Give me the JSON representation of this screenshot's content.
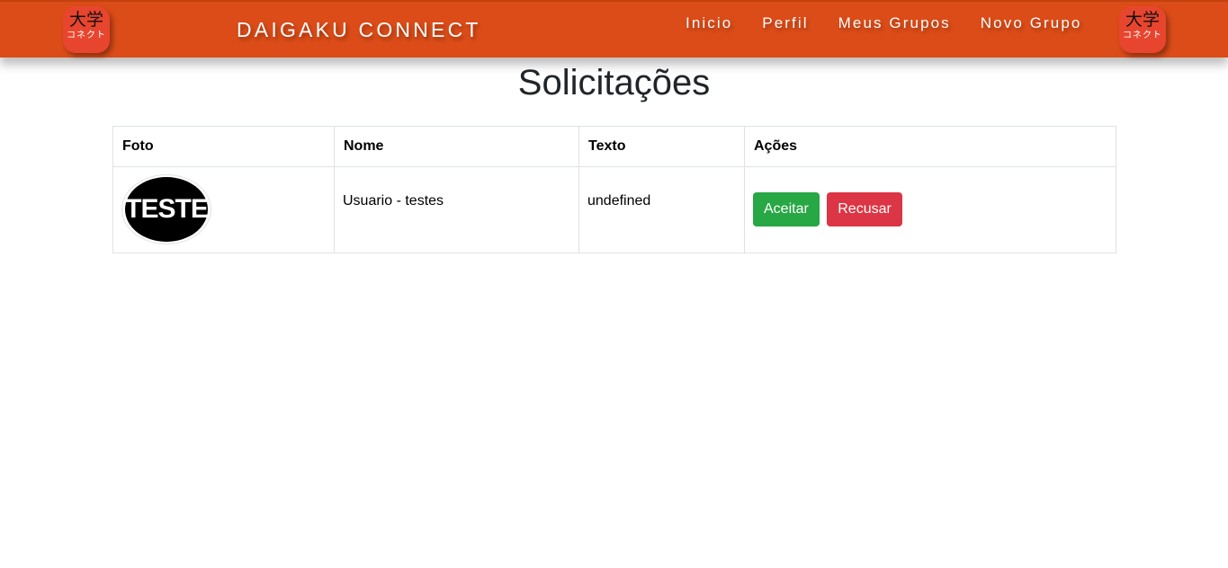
{
  "header": {
    "logo": {
      "kanji": "大学",
      "kana": "コネクト"
    },
    "brand": "DAIGAKU CONNECT",
    "nav": [
      "Inicio",
      "Perfil",
      "Meus Grupos",
      "Novo Grupo"
    ]
  },
  "page": {
    "title": "Solicitações"
  },
  "table": {
    "columns": [
      "Foto",
      "Nome",
      "Texto",
      "Ações"
    ],
    "rows": [
      {
        "photo_text": "TESTE",
        "name": "Usuario - testes",
        "text": "undefined",
        "accept_label": "Aceitar",
        "reject_label": "Recusar"
      }
    ]
  },
  "colors": {
    "navbar": "#dc4c18",
    "accept": "#28a745",
    "reject": "#dc3545"
  }
}
